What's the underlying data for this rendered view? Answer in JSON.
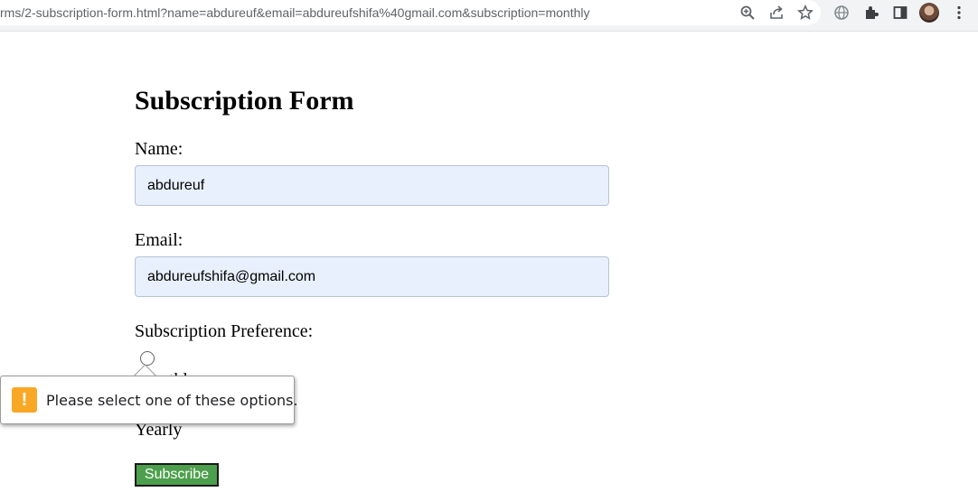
{
  "browser": {
    "url": "rms/2-subscription-form.html?name=abdureuf&email=abdureufshifa%40gmail.com&subscription=monthly",
    "icons": [
      "zoom-icon",
      "share-icon",
      "star-icon",
      "globe-icon",
      "extensions-icon",
      "sidepanel-icon",
      "avatar",
      "menu-icon"
    ]
  },
  "form": {
    "title": "Subscription Form",
    "name_label": "Name:",
    "name_value": "abdureuf",
    "email_label": "Email:",
    "email_value": "abdureufshifa@gmail.com",
    "preference_label": "Subscription Preference:",
    "options": [
      {
        "label": "Monthly",
        "checked": false
      },
      {
        "label": "Yearly",
        "checked": false
      }
    ],
    "submit_label": "Subscribe"
  },
  "validation": {
    "message": "Please select one of these options."
  },
  "colors": {
    "autofill_bg": "#e8f0fe",
    "submit_bg": "#4c9f4c",
    "warning": "#f9a825"
  }
}
